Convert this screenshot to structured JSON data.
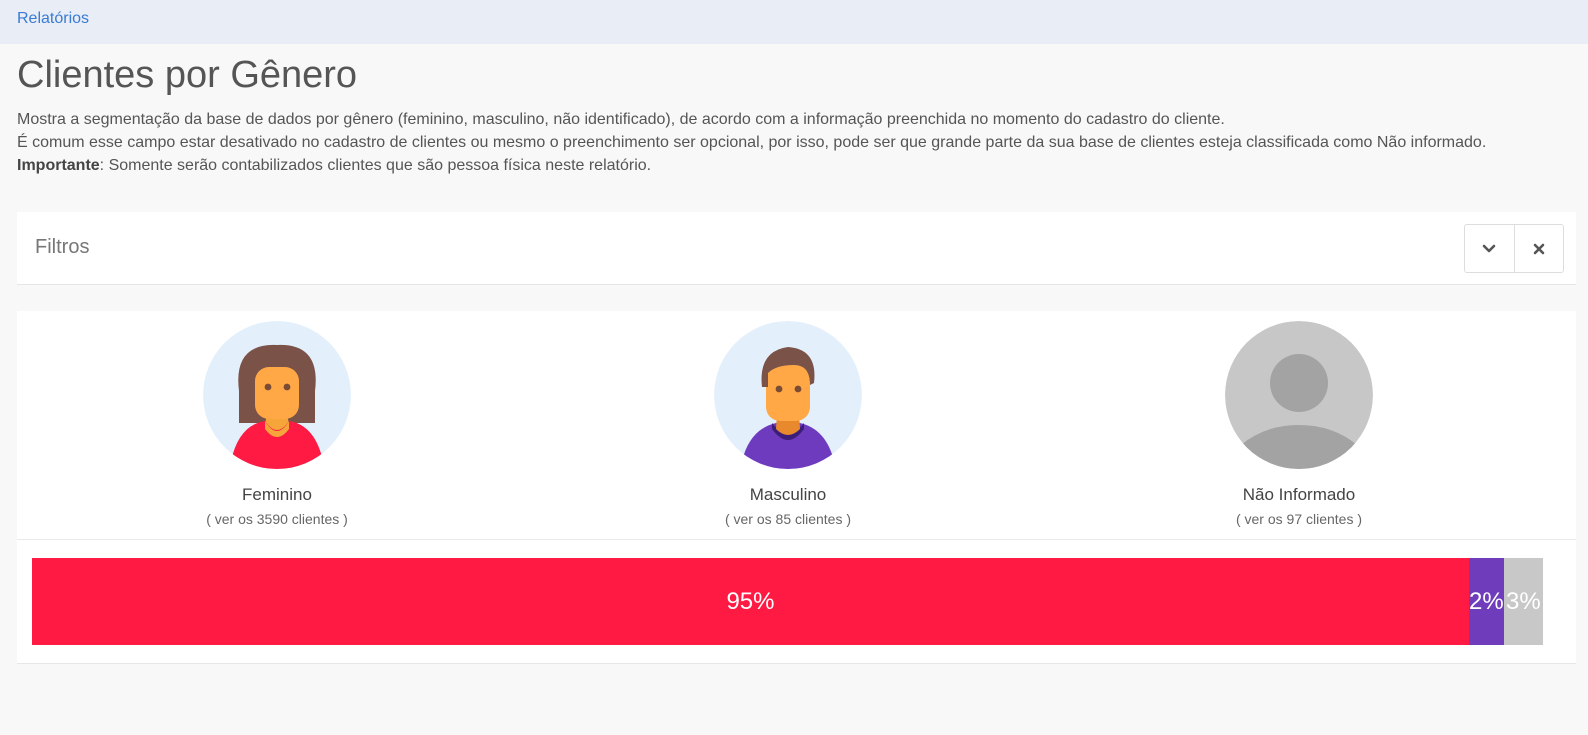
{
  "breadcrumb": {
    "label": "Relatórios"
  },
  "page": {
    "title": "Clientes por Gênero",
    "description_line1": "Mostra a segmentação da base de dados por gênero (feminino, masculino, não identificado), de acordo com a informação preenchida no momento do cadastro do cliente.",
    "description_line2": "É comum esse campo estar desativado no cadastro de clientes ou mesmo o preenchimento ser opcional, por isso, pode ser que grande parte da sua base de clientes esteja classificada como Não informado.",
    "important_label": "Importante",
    "important_text": ": Somente serão contabilizados clientes que são pessoa física neste relatório."
  },
  "filters": {
    "title": "Filtros",
    "toggle_icon": "chevron-down-icon",
    "close_icon": "close-icon"
  },
  "genders": [
    {
      "label": "Feminino",
      "link": "( ver os 3590 clientes )",
      "icon": "female-avatar-icon"
    },
    {
      "label": "Masculino",
      "link": "( ver os 85 clientes )",
      "icon": "male-avatar-icon"
    },
    {
      "label": "Não Informado",
      "link": "( ver os 97 clientes )",
      "icon": "unknown-avatar-icon"
    }
  ],
  "distribution": [
    {
      "label": "95%",
      "share": 0.951,
      "color": "#ff1a44"
    },
    {
      "label": "2%",
      "share": 0.023,
      "color": "#6f3cbc"
    },
    {
      "label": "3%",
      "share": 0.026,
      "color": "#c8c8c8"
    }
  ]
}
